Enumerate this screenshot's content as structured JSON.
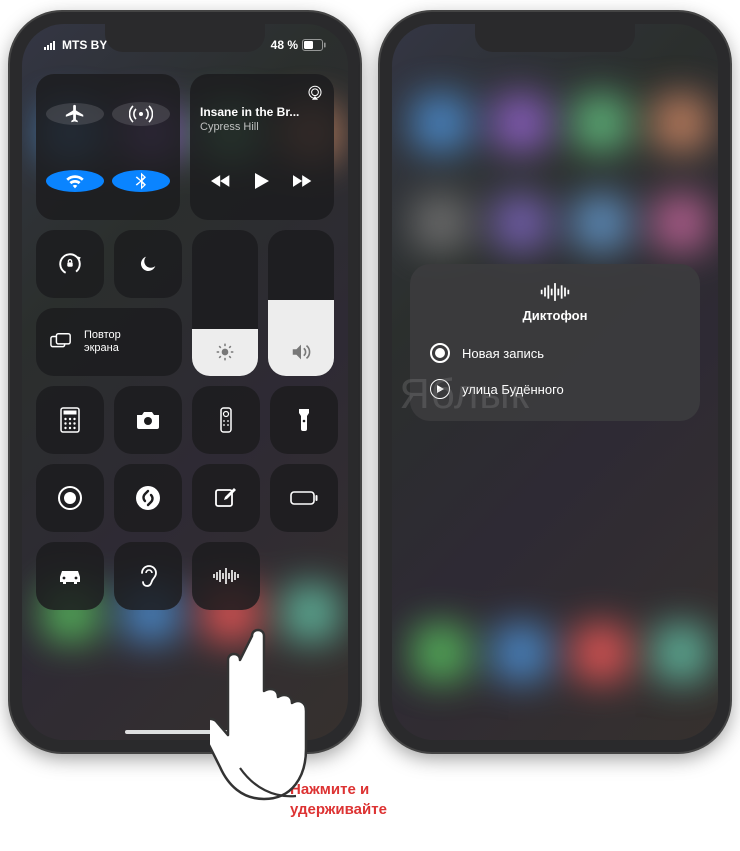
{
  "statusbar": {
    "carrier": "MTS BY",
    "battery_text": "48 %"
  },
  "connectivity": {
    "airplane": {
      "name": "airplane-mode",
      "on": false
    },
    "cellular": {
      "name": "cellular-data",
      "on": false
    },
    "wifi": {
      "name": "wifi",
      "on": true
    },
    "bluetooth": {
      "name": "bluetooth",
      "on": true
    }
  },
  "media": {
    "title": "Insane in the Br...",
    "artist": "Cypress Hill"
  },
  "screen_mirror": {
    "label": "Повтор\nэкрана"
  },
  "shortcuts": [
    {
      "name": "calculator-icon"
    },
    {
      "name": "camera-icon"
    },
    {
      "name": "remote-icon"
    },
    {
      "name": "flashlight-icon"
    },
    {
      "name": "screen-record-icon"
    },
    {
      "name": "shazam-icon"
    },
    {
      "name": "compose-icon"
    },
    {
      "name": "low-power-icon"
    },
    {
      "name": "car-icon"
    },
    {
      "name": "hearing-icon"
    },
    {
      "name": "voice-memo-icon"
    }
  ],
  "voice_memo_panel": {
    "title": "Диктофон",
    "items": [
      {
        "kind": "new",
        "label": "Новая запись"
      },
      {
        "kind": "play",
        "label": "улица Будённого"
      }
    ]
  },
  "caption": {
    "line1": "Нажмите и",
    "line2": "удерживайте"
  },
  "watermark": "Яблык"
}
